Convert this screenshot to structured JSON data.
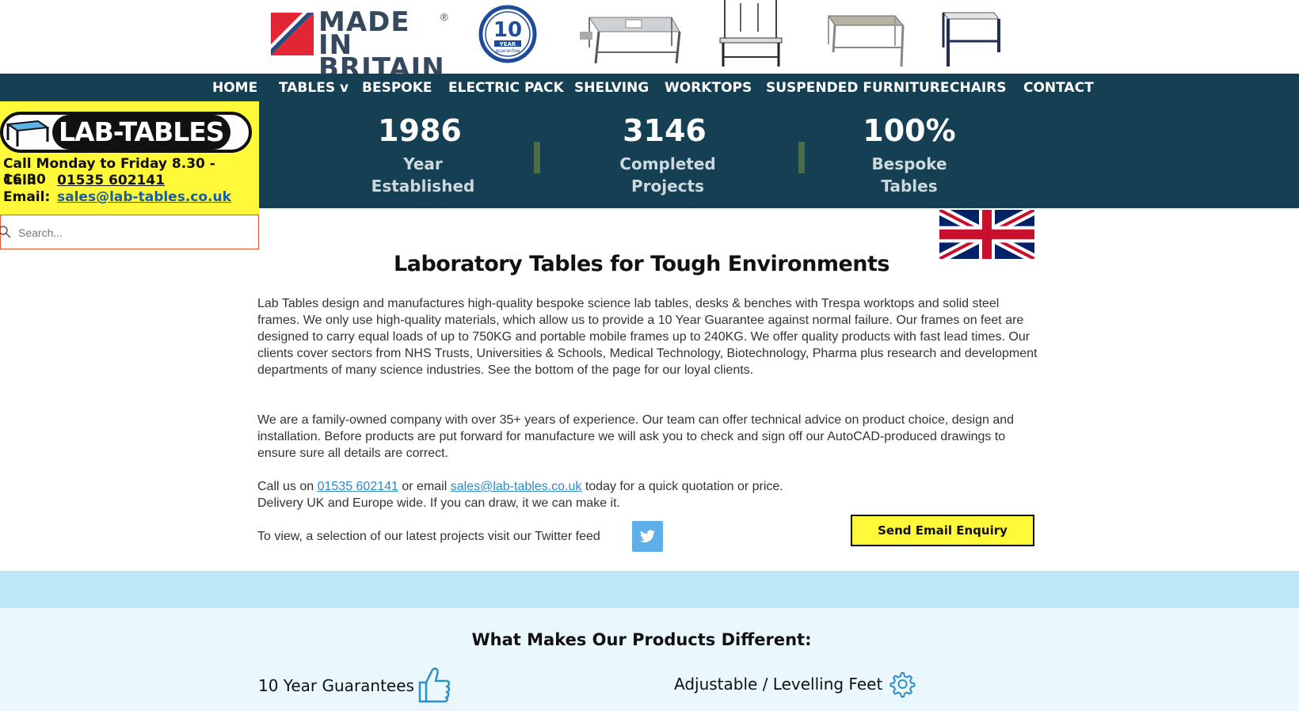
{
  "banner": {
    "made_in_line1": "MADE IN",
    "made_in_line2": "BRITAIN",
    "made_in_reg": "®",
    "guarantee_num": "10",
    "guarantee_word1": "YEAR",
    "guarantee_word2": "guarantee"
  },
  "nav": {
    "items": [
      "HOME",
      "TABLES v",
      "BESPOKE",
      "ELECTRIC PACK",
      "SHELVING",
      "WORKTOPS",
      "SUSPENDED FURNITURE",
      "CHAIRS",
      "CONTACT"
    ]
  },
  "stats": [
    {
      "number": "1986",
      "line1": "Year",
      "line2": "Established"
    },
    {
      "number": "3146",
      "line1": "Completed",
      "line2": "Projects"
    },
    {
      "number": "100%",
      "line1": "Bespoke",
      "line2": "Tables"
    }
  ],
  "info": {
    "logo_text": "LAB-TABLES",
    "hours": "Call Monday to Friday 8.30 - 16.30",
    "call_label": "Call:",
    "call_number": "01535 602141",
    "email_label": "Email:",
    "email": "sales@lab-tables.co.uk"
  },
  "search": {
    "placeholder": "Search..."
  },
  "main": {
    "title": "Laboratory Tables for Tough Environments",
    "para1": "Lab Tables design and manufactures high-quality bespoke science lab tables, desks & benches with Trespa worktops and solid steel frames. We only use high-quality materials, which allow us to provide a 10 Year Guarantee against normal failure. Our frames on feet are designed to carry equal loads of up to 750KG and portable mobile frames up to 240KG. We offer quality products with fast lead times. Our clients cover sectors from NHS Trusts, Universities & Schools, Medical Technology, Biotechnology, Pharma plus research and development departments of many science industries. See the bottom of the page for our loyal clients.",
    "para2": "We are a family-owned company with over 35+ years of experience. Our team can offer technical advice on product choice, design and installation. Before products are put forward for manufacture we will ask you to check and sign off our AutoCAD-produced drawings to ensure sure all details are correct.",
    "call_prefix": "Call us on ",
    "call_number": "01535 602141",
    "call_mid": " or email ",
    "call_email": "sales@lab-tables.co.uk",
    "call_suffix": " today for a quick quotation or price.",
    "delivery": "Delivery UK and Europe wide. If you can draw, it we can make it.",
    "twitter_text": "To view, a selection of our latest projects visit our Twitter feed",
    "send_button": "Send Email Enquiry"
  },
  "features": {
    "title": "What Makes Our Products Different:",
    "item1": "10 Year Guarantees",
    "item2": "Adjustable / Levelling Feet"
  },
  "colors": {
    "nav_bg": "#153f53",
    "yellow": "#fff93a",
    "light_blue": "#bde6f8"
  }
}
